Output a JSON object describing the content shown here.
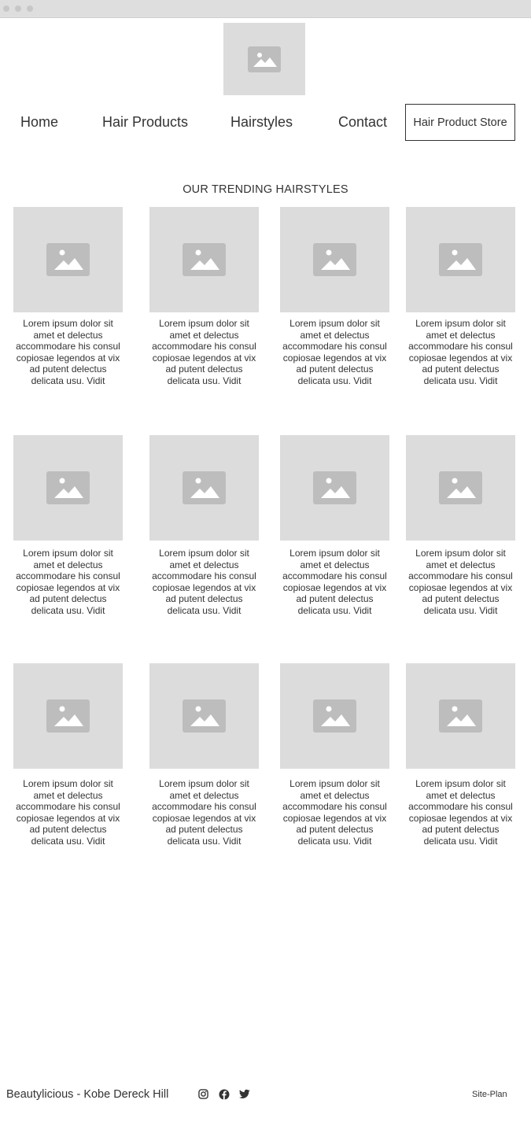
{
  "nav": {
    "links": [
      "Home",
      "Hair Products",
      "Hairstyles",
      "Contact"
    ],
    "store_button": "Hair Product Store"
  },
  "main": {
    "section_title": "OUR TRENDING HAIRSTYLES",
    "cards": [
      {
        "text": "Lorem ipsum dolor sit amet et delectus accommodare his consul copiosae legendos at vix ad putent delectus delicata usu. Vidit"
      },
      {
        "text": "Lorem ipsum dolor sit amet et delectus accommodare his consul copiosae legendos at vix ad putent delectus delicata usu. Vidit"
      },
      {
        "text": "Lorem ipsum dolor sit amet et delectus accommodare his consul copiosae legendos at vix ad putent delectus delicata usu. Vidit"
      },
      {
        "text": "Lorem ipsum dolor sit amet et delectus accommodare his consul copiosae legendos at vix ad putent delectus delicata usu. Vidit"
      },
      {
        "text": "Lorem ipsum dolor sit amet et delectus accommodare his consul copiosae legendos at vix ad putent delectus delicata usu. Vidit"
      },
      {
        "text": "Lorem ipsum dolor sit amet et delectus accommodare his consul copiosae legendos at vix ad putent delectus delicata usu. Vidit"
      },
      {
        "text": "Lorem ipsum dolor sit amet et delectus accommodare his consul copiosae legendos at vix ad putent delectus delicata usu. Vidit"
      },
      {
        "text": "Lorem ipsum dolor sit amet et delectus accommodare his consul copiosae legendos at vix ad putent delectus delicata usu. Vidit"
      },
      {
        "text": "Lorem ipsum dolor sit amet et delectus accommodare his consul copiosae legendos at vix ad putent delectus delicata usu. Vidit"
      },
      {
        "text": "Lorem ipsum dolor sit amet et delectus accommodare his consul copiosae legendos at vix ad putent delectus delicata usu. Vidit"
      },
      {
        "text": "Lorem ipsum dolor sit amet et delectus accommodare his consul copiosae legendos at vix ad putent delectus delicata usu. Vidit"
      },
      {
        "text": "Lorem ipsum dolor sit amet et delectus accommodare his consul copiosae legendos at vix ad putent delectus delicata usu. Vidit"
      }
    ]
  },
  "footer": {
    "brand": "Beautylicious - Kobe Dereck Hill",
    "social_icons": [
      "instagram-icon",
      "facebook-icon",
      "twitter-icon"
    ],
    "site_plan": "Site-Plan"
  },
  "colors": {
    "placeholder_bg": "#dcdcdc",
    "placeholder_icon": "#bdbdbd",
    "text": "#333333",
    "titlebar": "#dedede"
  }
}
